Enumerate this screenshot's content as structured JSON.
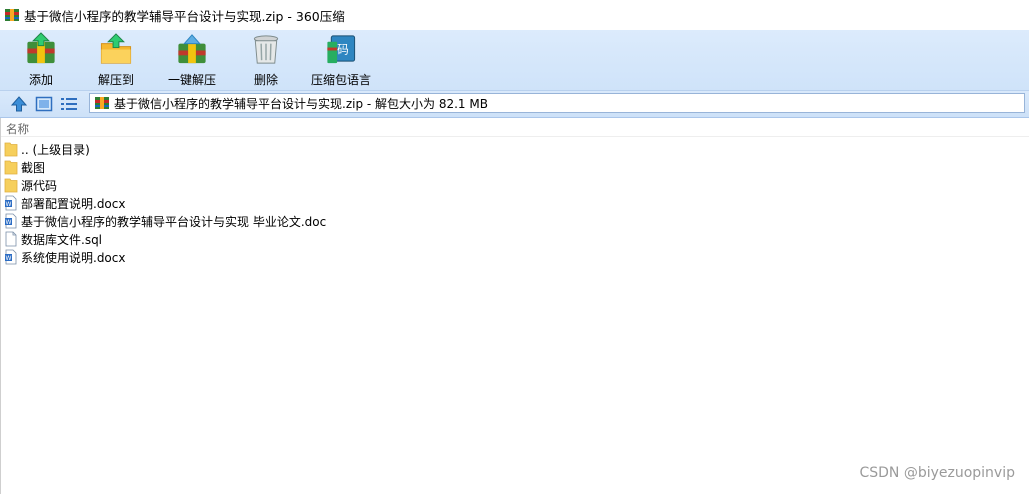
{
  "window": {
    "title": "基于微信小程序的教学辅导平台设计与实现.zip - 360压缩",
    "app_icon": "archive-icon"
  },
  "toolbar": {
    "buttons": [
      {
        "label": "添加",
        "icon": "add-archive-icon"
      },
      {
        "label": "解压到",
        "icon": "extract-to-icon"
      },
      {
        "label": "一键解压",
        "icon": "quick-extract-icon"
      },
      {
        "label": "删除",
        "icon": "trash-icon"
      },
      {
        "label": "压缩包语言",
        "icon": "archive-encoding-icon"
      }
    ]
  },
  "addressbar": {
    "path_text": "基于微信小程序的教学辅导平台设计与实现.zip - 解包大小为 82.1 MB"
  },
  "filelist": {
    "column_header": "名称",
    "items": [
      {
        "name": ".. (上级目录)",
        "type": "folder"
      },
      {
        "name": "截图",
        "type": "folder"
      },
      {
        "name": "源代码",
        "type": "folder"
      },
      {
        "name": "部署配置说明.docx",
        "type": "word"
      },
      {
        "name": "基于微信小程序的教学辅导平台设计与实现 毕业论文.doc",
        "type": "word"
      },
      {
        "name": "数据库文件.sql",
        "type": "file"
      },
      {
        "name": "系统使用说明.docx",
        "type": "word"
      }
    ]
  },
  "watermark": "CSDN @biyezuopinvip",
  "colors": {
    "toolbar_bg": "#d6e8fb",
    "folder": "#f6cf5c",
    "word_blue": "#2b6cc4"
  }
}
